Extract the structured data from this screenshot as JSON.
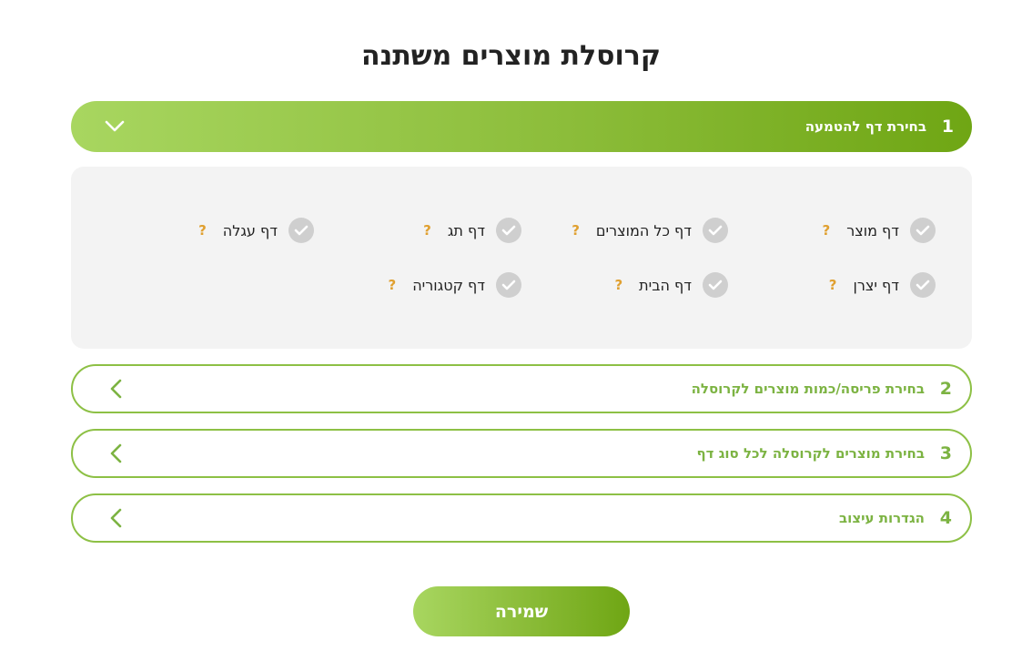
{
  "page": {
    "title": "קרוסלת מוצרים משתנה"
  },
  "colors": {
    "accent": "#8cbd3a",
    "accent_dark": "#6fa614",
    "help": "#e0a030",
    "panel_bg": "#f3f3f3",
    "check_bg": "#cfcfcf"
  },
  "sections": [
    {
      "number": "1",
      "title": "בחירת דף להטמעה",
      "state": "open",
      "icon": "chevron-down-icon"
    },
    {
      "number": "2",
      "title": "בחירת פריסה/כמות מוצרים לקרוסלה",
      "state": "closed",
      "icon": "chevron-left-icon"
    },
    {
      "number": "3",
      "title": "בחירת מוצרים לקרוסלה לכל סוג דף",
      "state": "closed",
      "icon": "chevron-left-icon"
    },
    {
      "number": "4",
      "title": "הגדרות עיצוב",
      "state": "closed",
      "icon": "chevron-left-icon"
    }
  ],
  "page_options": [
    {
      "label": "דף מוצר",
      "help": "?",
      "checked": false
    },
    {
      "label": "דף כל המוצרים",
      "help": "?",
      "checked": false
    },
    {
      "label": "דף תג",
      "help": "?",
      "checked": false
    },
    {
      "label": "דף עגלה",
      "help": "?",
      "checked": false
    },
    {
      "label": "דף יצרן",
      "help": "?",
      "checked": false
    },
    {
      "label": "דף הבית",
      "help": "?",
      "checked": false
    },
    {
      "label": "דף קטגוריה",
      "help": "?",
      "checked": false
    }
  ],
  "actions": {
    "save_label": "שמירה"
  }
}
